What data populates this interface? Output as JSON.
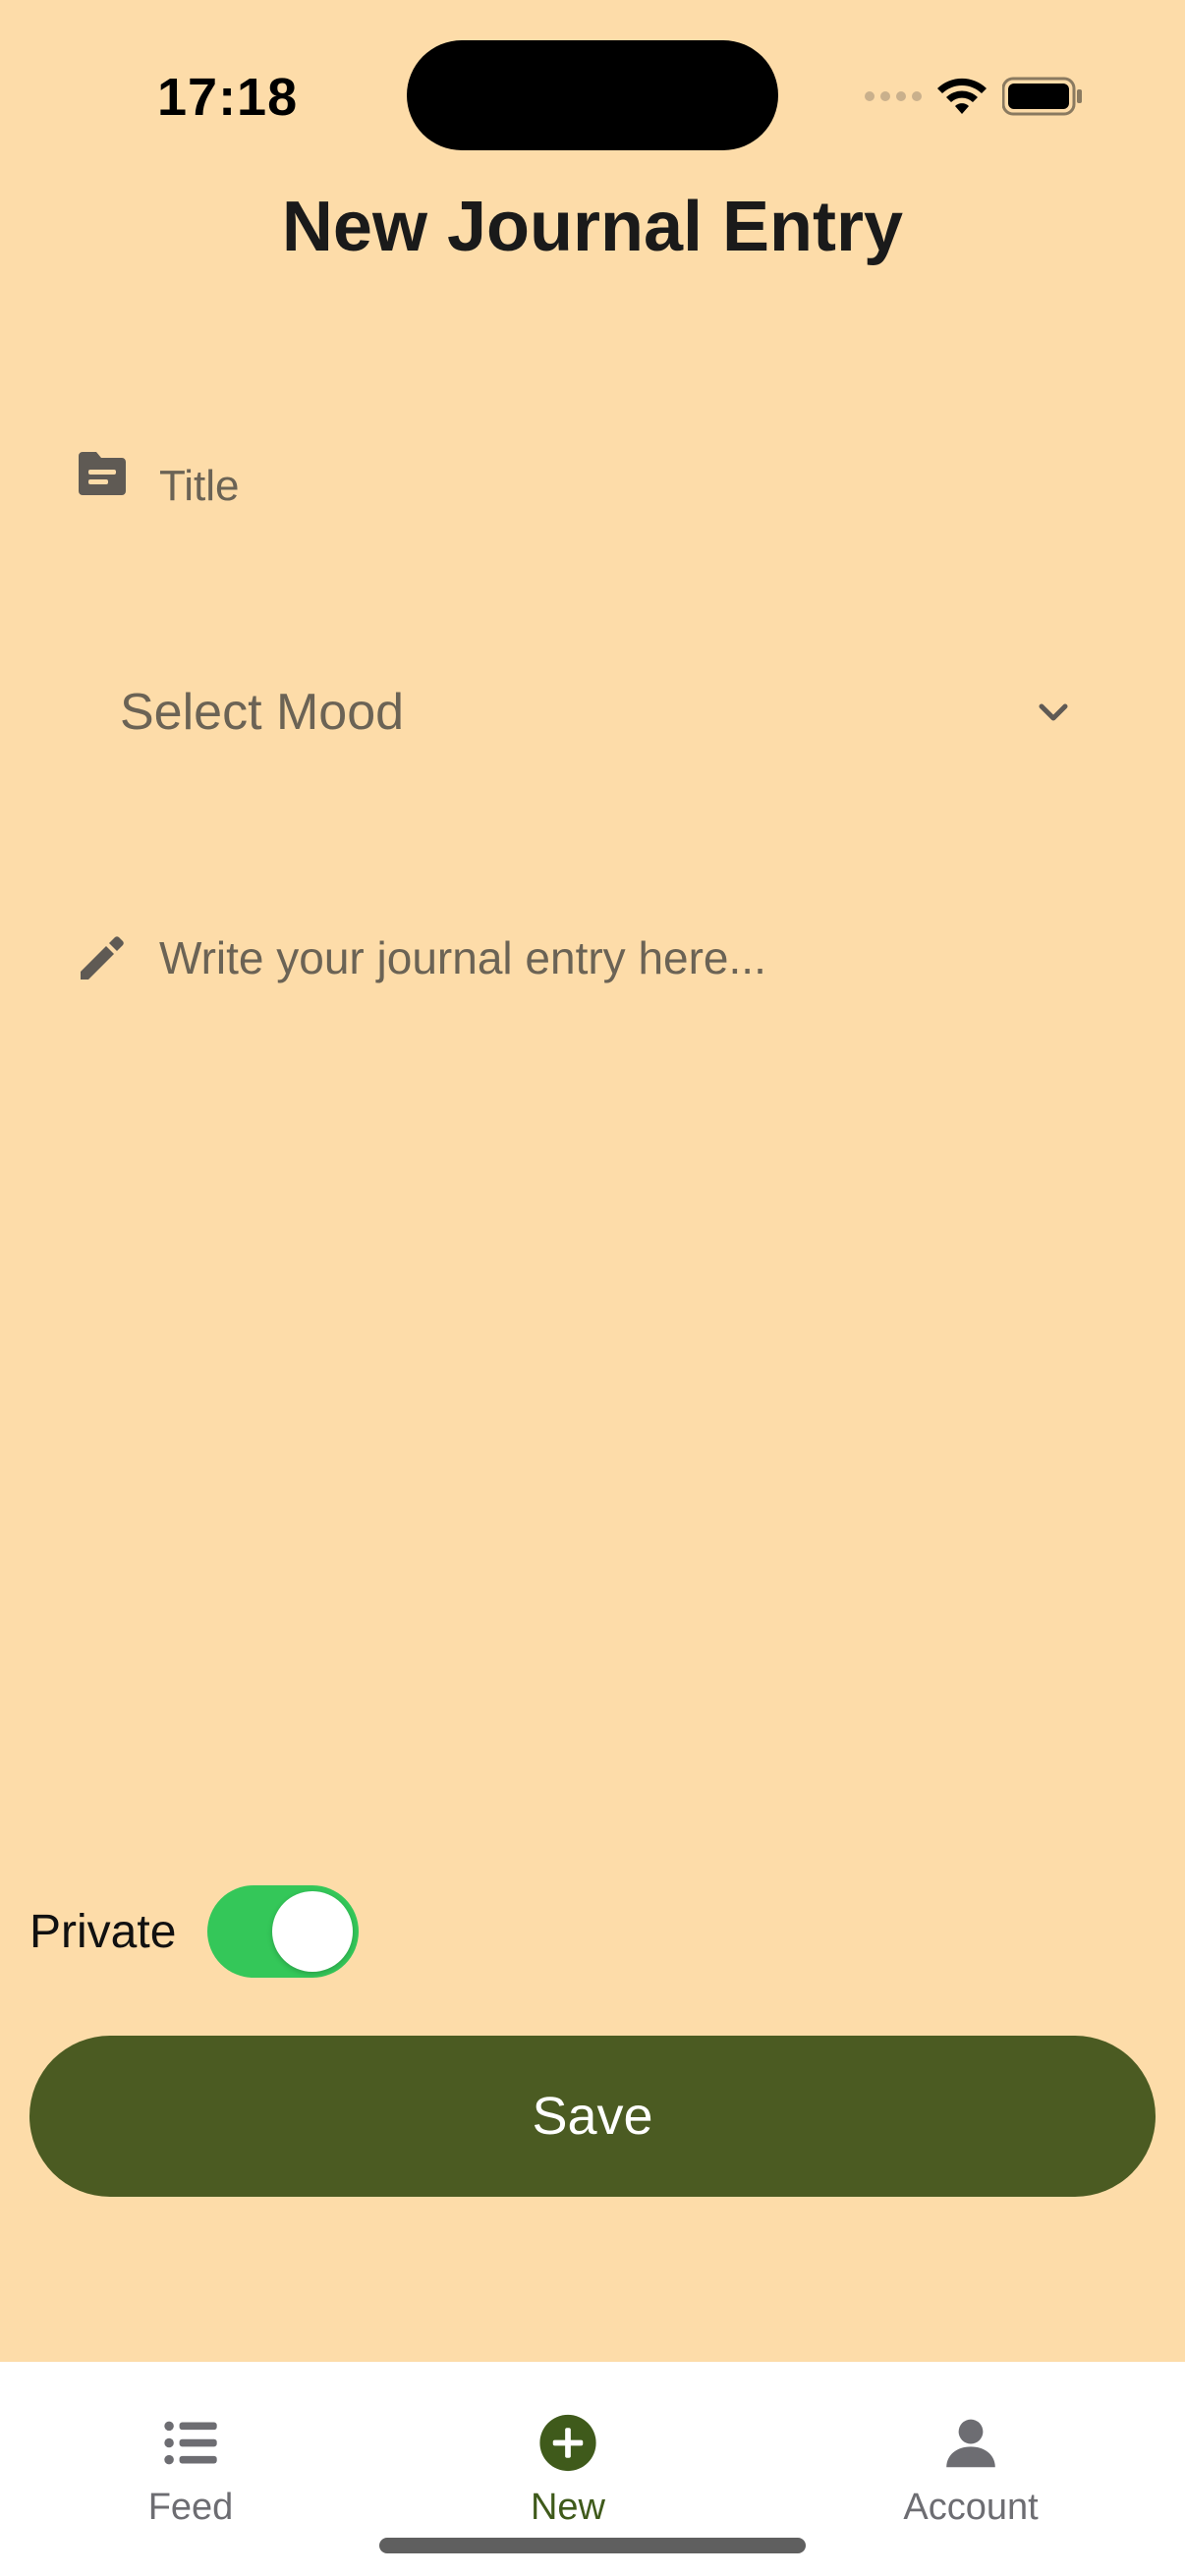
{
  "status_bar": {
    "time": "17:18"
  },
  "header": {
    "title": "New Journal Entry"
  },
  "form": {
    "title_field": {
      "placeholder": "Title",
      "value": "",
      "icon": "file-note-icon"
    },
    "mood_select": {
      "label": "Select Mood",
      "icon": "chevron-down-icon"
    },
    "entry_field": {
      "placeholder": "Write your journal entry here...",
      "value": "",
      "icon": "pencil-icon"
    },
    "private_toggle": {
      "label": "Private",
      "on": true,
      "color": "#34C759"
    },
    "save_button": {
      "label": "Save",
      "color": "#4B5B22"
    }
  },
  "tab_bar": {
    "tabs": [
      {
        "label": "Feed",
        "icon": "list-icon",
        "active": false
      },
      {
        "label": "New",
        "icon": "plus-circle-icon",
        "active": true
      },
      {
        "label": "Account",
        "icon": "person-icon",
        "active": false
      }
    ],
    "active_color": "#3F5A1B"
  },
  "theme": {
    "background": "#FDDCA9"
  }
}
